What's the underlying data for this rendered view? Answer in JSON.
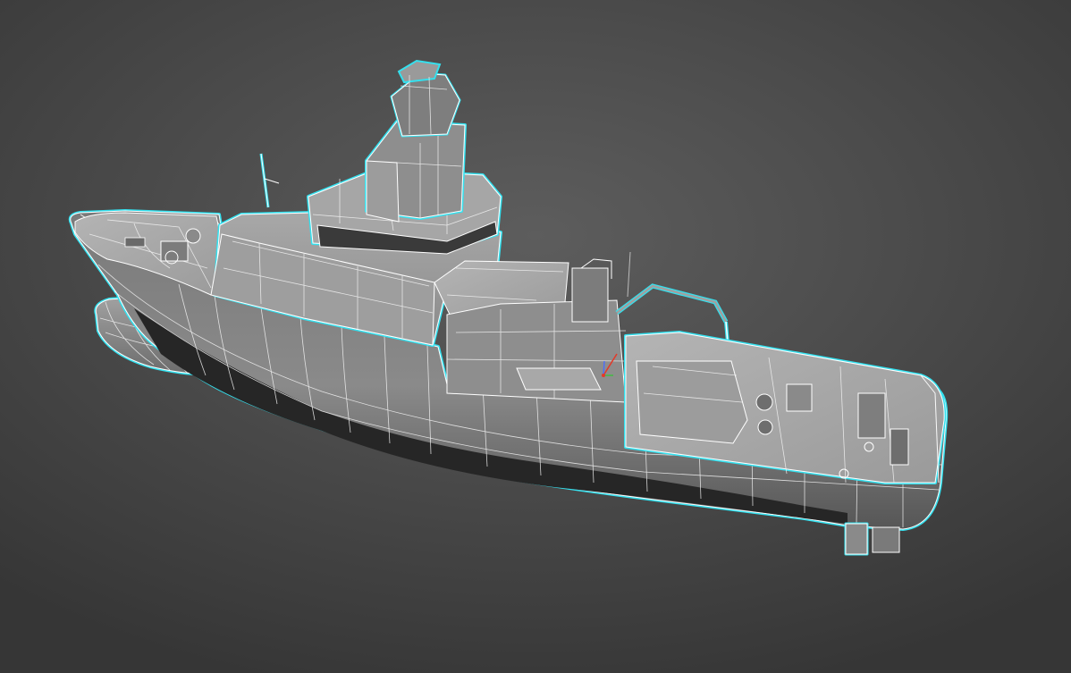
{
  "viewport": {
    "background": "#4a4a4a",
    "selection_color": "#34e0ee",
    "wireframe_color": "#ffffff",
    "shaded_color": "#8c8c8c"
  },
  "scene": {
    "object": "ship-model",
    "selected": true,
    "display_mode": "shaded-with-edged-faces"
  },
  "gizmo": {
    "axis_colors": {
      "x": "#e23a2a",
      "y": "#3fbf3f",
      "z": "#4a6cff"
    }
  }
}
